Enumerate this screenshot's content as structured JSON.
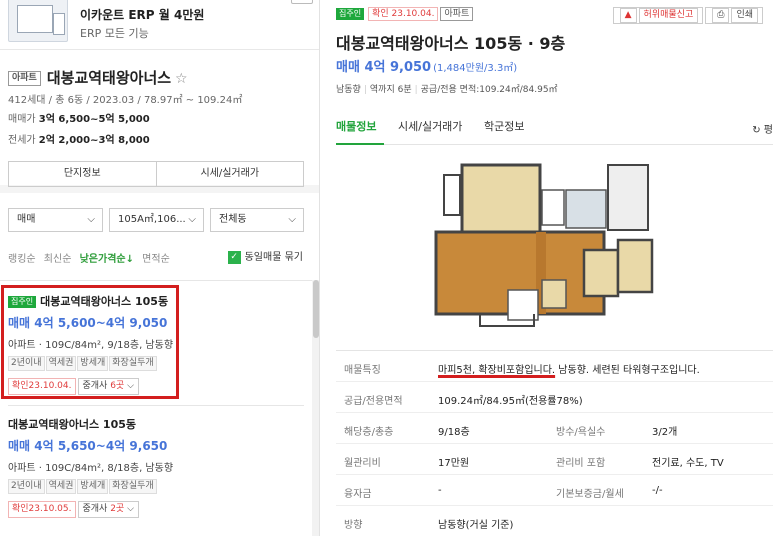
{
  "ad": {
    "title": "이카운트 ERP 월 4만원",
    "subtitle": "ERP 모든 기능"
  },
  "complex": {
    "type_tag": "아파트",
    "name": "대봉교역태왕아너스",
    "star": "☆",
    "meta": "412세대 / 총 6동 / 2023.03 / 78.97㎡ ~ 109.24㎡",
    "sale_label": "매매가",
    "sale_value": "3억 6,500~5억 5,000",
    "jeonse_label": "전세가",
    "jeonse_value": "2억 2,000~3억 8,000",
    "buttons": [
      "단지정보",
      "시세/실거래가"
    ]
  },
  "filters": {
    "trade": "매매",
    "area": "105A㎡,106...",
    "dong": "전체동"
  },
  "sort": {
    "items": [
      "랭킹순",
      "최신순",
      "낮은가격순↓",
      "면적순"
    ],
    "active_index": 2,
    "same_listing_label": "동일매물 묶기",
    "check_mark": "✓"
  },
  "listings": [
    {
      "owner_tag": "집주인",
      "title": "대봉교역태왕아너스 105동",
      "price": "매매 4억 5,600~4억 9,050",
      "spec": "아파트 · 109C/84m², 9/18층, 남동향",
      "tags": [
        "2년이내",
        "역세권",
        "방세개",
        "화장실두개"
      ],
      "confirmed": "확인23.10.04.",
      "agent_prefix": "중개사 ",
      "agent_num": "6곳",
      "agent_suffix": " ⌵"
    },
    {
      "owner_tag": "",
      "title": "대봉교역태왕아너스 105동",
      "price": "매매 4억 5,650~4억 9,650",
      "spec": "아파트 · 109C/84m², 8/18층, 남동향",
      "tags": [
        "2년이내",
        "역세권",
        "방세개",
        "화장실두개"
      ],
      "confirmed": "확인23.10.05.",
      "agent_prefix": "중개사 ",
      "agent_num": "2곳",
      "agent_suffix": " ⌵"
    }
  ],
  "detail": {
    "owner_tag": "집주인",
    "confirmed": "확인 23.10.04.",
    "type_tag": "아파트",
    "report": "허위매물신고",
    "print": "인쇄",
    "title": "대봉교역태왕아너스 105동 · 9층",
    "price": "매매 4억 9,050",
    "price_per": "(1,484만원/3.3㎡)",
    "meta": [
      "남동향",
      "역까지 6분",
      "공급/전용 면적:109.24㎡/84.95㎡"
    ],
    "tabs": [
      "매물정보",
      "시세/실거래가",
      "학군정보"
    ],
    "refresh": "↻ 평"
  },
  "info": {
    "feature_label": "매물특징",
    "feature_underlined": "마피5천, 확장비포함입니다.",
    "feature_rest": " 남동향. 세련된 타워형구조입니다.",
    "area_label": "공급/전용면적",
    "area_value": "109.24㎡/84.95㎡(전용률78%)",
    "floor_label": "해당층/총층",
    "floor_value": "9/18층",
    "rooms_label": "방수/욕실수",
    "rooms_value": "3/2개",
    "mgmt_label": "월관리비",
    "mgmt_value": "17만원",
    "mgmt_inc_label": "관리비 포함",
    "mgmt_inc_value": "전기료, 수도, TV",
    "loan_label": "융자금",
    "loan_value": "-",
    "deposit_label": "기본보증금/월세",
    "deposit_value": "-/-",
    "dir_label": "방향",
    "dir_value": "남동향(거실 기준)"
  }
}
